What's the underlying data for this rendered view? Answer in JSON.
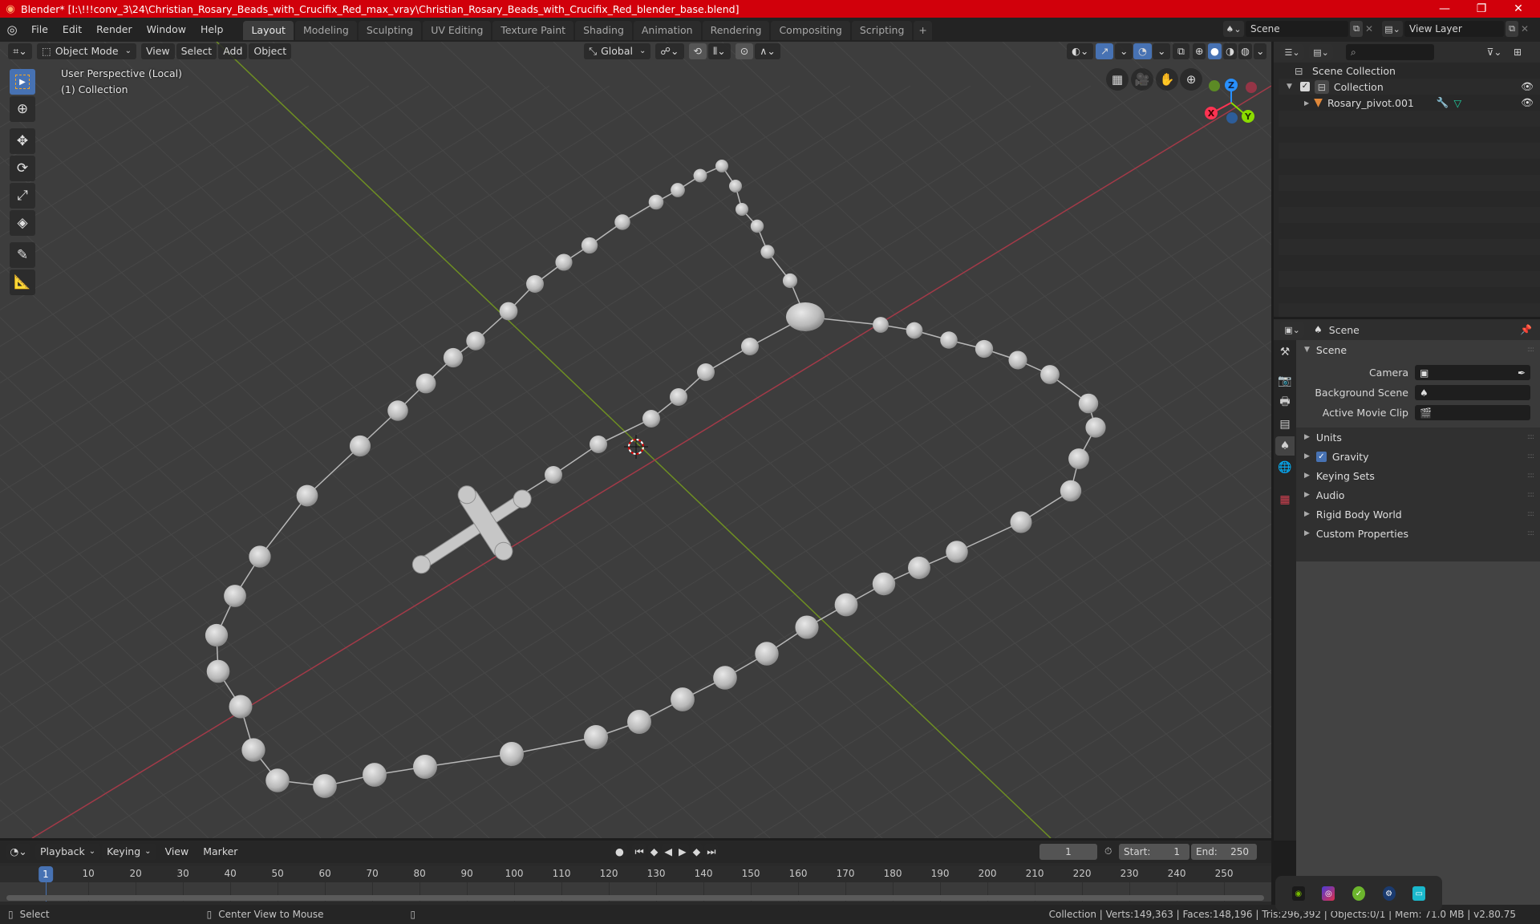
{
  "window": {
    "title": "Blender* [I:\\!!!conv_3\\24\\Christian_Rosary_Beads_with_Crucifix_Red_max_vray\\Christian_Rosary_Beads_with_Crucifix_Red_blender_base.blend]",
    "controls": {
      "minimize": "—",
      "maximize": "❐",
      "close": "✕"
    },
    "titlebar_color": "#d1000b"
  },
  "menu": [
    "File",
    "Edit",
    "Render",
    "Window",
    "Help"
  ],
  "workspaces": [
    {
      "label": "Layout",
      "active": true
    },
    {
      "label": "Modeling"
    },
    {
      "label": "Sculpting"
    },
    {
      "label": "UV Editing"
    },
    {
      "label": "Texture Paint"
    },
    {
      "label": "Shading"
    },
    {
      "label": "Animation"
    },
    {
      "label": "Rendering"
    },
    {
      "label": "Compositing"
    },
    {
      "label": "Scripting"
    }
  ],
  "add_workspace": "+",
  "scene_selector": {
    "value": "Scene"
  },
  "view_layer_selector": {
    "value": "View Layer"
  },
  "viewport": {
    "mode": "Object Mode",
    "menus": [
      "View",
      "Select",
      "Add",
      "Object"
    ],
    "transform_orientation": "Global",
    "overlay_line1": "User Perspective (Local)",
    "overlay_line2": "(1) Collection",
    "gizmo_axes": {
      "x": "X",
      "y": "Y",
      "z": "Z"
    },
    "axis_colors": {
      "x": "#ff3352",
      "y": "#8bdc00",
      "z": "#2890ff"
    },
    "bg_color": "#3d3d3d"
  },
  "outliner": {
    "root": "Scene Collection",
    "items": [
      {
        "label": "Collection",
        "type": "collection",
        "checked": true
      },
      {
        "label": "Rosary_pivot.001",
        "type": "mesh-object"
      }
    ]
  },
  "properties": {
    "context": "Scene",
    "panel_scene": {
      "title": "Scene",
      "fields": [
        {
          "label": "Camera",
          "value": ""
        },
        {
          "label": "Background Scene",
          "value": ""
        },
        {
          "label": "Active Movie Clip",
          "value": ""
        }
      ]
    },
    "panels": [
      {
        "title": "Units"
      },
      {
        "title": "Gravity",
        "checkbox": true
      },
      {
        "title": "Keying Sets"
      },
      {
        "title": "Audio"
      },
      {
        "title": "Rigid Body World"
      },
      {
        "title": "Custom Properties"
      }
    ]
  },
  "timeline": {
    "menus": [
      "Playback",
      "Keying",
      "View",
      "Marker"
    ],
    "current_frame": "1",
    "start_label": "Start:",
    "start": "1",
    "end_label": "End:",
    "end": "250",
    "ruler_ticks": [
      "1",
      "10",
      "20",
      "30",
      "40",
      "50",
      "60",
      "70",
      "80",
      "90",
      "100",
      "110",
      "120",
      "130",
      "140",
      "150",
      "160",
      "170",
      "180",
      "190",
      "200",
      "210",
      "220",
      "230",
      "240",
      "250"
    ]
  },
  "statusbar": {
    "select": "Select",
    "center_view": "Center View to Mouse",
    "stats": "Collection | Verts:149,363 | Faces:148,196 | Tris:296,392 | Objects:0/1 | Mem: 71.0 MB | v2.80.75"
  },
  "tray_icons": [
    "nvidia-icon",
    "headset-app-icon",
    "check-shield-icon",
    "steam-icon",
    "display-app-icon"
  ]
}
